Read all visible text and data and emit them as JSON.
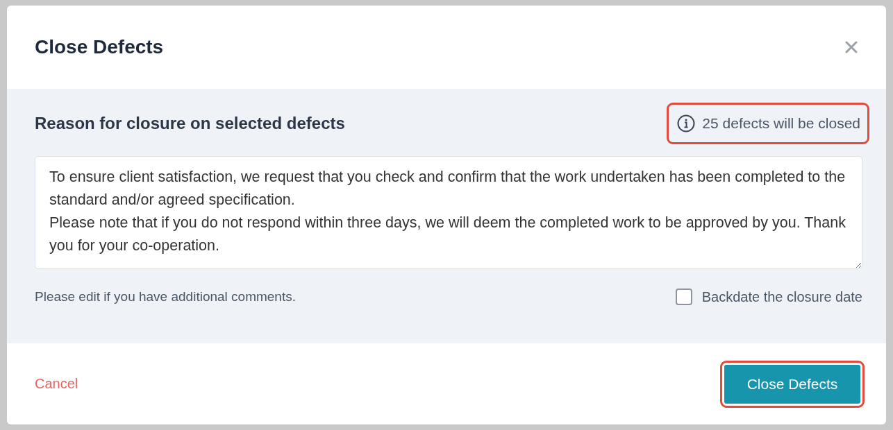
{
  "modal": {
    "title": "Close Defects",
    "heading": "Reason for closure on selected defects",
    "notice": {
      "text": "25 defects will be closed",
      "highlighted": true
    },
    "message": "To ensure client satisfaction, we request that you check and confirm that the work undertaken has been completed to the standard and/or agreed specification.\nPlease note that if you do not respond within three days, we will deem the completed work to be approved by you. Thank you for your co-operation.",
    "hint": "Please edit if you have additional comments.",
    "backdate": {
      "label": "Backdate the closure date",
      "checked": false
    },
    "cancel": "Cancel",
    "confirm": {
      "label": "Close Defects",
      "highlighted": true
    }
  }
}
